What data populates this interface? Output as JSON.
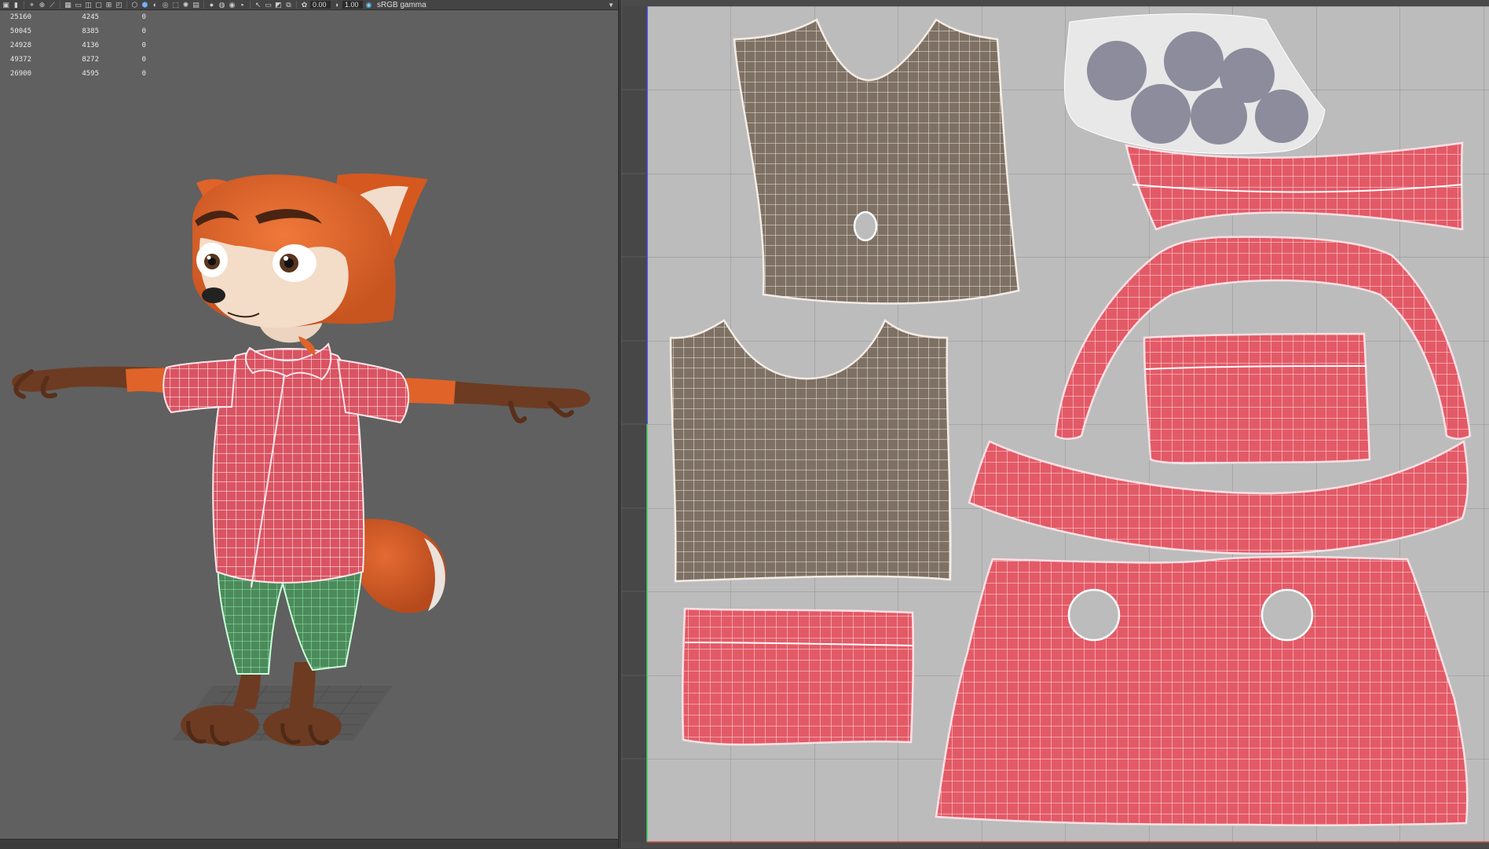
{
  "toolbar": {
    "exposure_value": "0.00",
    "gamma_value": "1.00",
    "color_space": "sRGB gamma",
    "icons": [
      "camera-icon",
      "bookmark-icon",
      "select-camera-icon",
      "lock-camera-icon",
      "pan-zoom-icon",
      "grid-icon",
      "film-gate-icon",
      "resolution-gate-icon",
      "safe-area-icon",
      "wireframe-icon",
      "smooth-shade-icon",
      "textured-icon",
      "lights-icon",
      "shadows-icon",
      "ambient-occlusion-icon",
      "motion-blur-icon",
      "anti-alias-icon",
      "depth-of-field-icon",
      "isolate-icon",
      "xray-icon",
      "xray-joints-icon",
      "xray-components-icon",
      "backface-icon",
      "exposure-icon",
      "gamma-icon",
      "color-management-icon"
    ]
  },
  "hud": {
    "rows": [
      {
        "a": "25160",
        "b": "4245",
        "c": "0"
      },
      {
        "a": "50045",
        "b": "8385",
        "c": "0"
      },
      {
        "a": "24928",
        "b": "4136",
        "c": "0"
      },
      {
        "a": "49372",
        "b": "8272",
        "c": "0"
      },
      {
        "a": "26900",
        "b": "4595",
        "c": "0"
      }
    ]
  },
  "colors": {
    "viewport_bg": "#606060",
    "uv_bg": "#bdbdbd",
    "shirt_shell": "#e8626d",
    "inner_shell": "#7d7064",
    "pants_wire": "#5fe08a",
    "fur": "#e0632a"
  }
}
